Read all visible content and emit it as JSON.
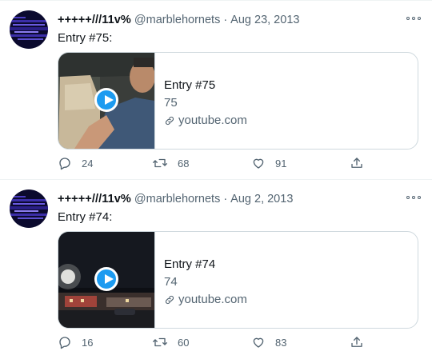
{
  "tweets": [
    {
      "name": "+++++///11v%",
      "handle": "@marblehornets",
      "separator": "·",
      "date": "Aug 23, 2013",
      "text": "Entry #75:",
      "card": {
        "title": "Entry #75",
        "description": "75",
        "domain": "youtube.com"
      },
      "actions": {
        "replies": "24",
        "retweets": "68",
        "likes": "91"
      }
    },
    {
      "name": "+++++///11v%",
      "handle": "@marblehornets",
      "separator": "·",
      "date": "Aug 2, 2013",
      "text": "Entry #74:",
      "card": {
        "title": "Entry #74",
        "description": "74",
        "domain": "youtube.com"
      },
      "actions": {
        "replies": "16",
        "retweets": "60",
        "likes": "83"
      }
    }
  ],
  "icons": {
    "more": "more-horizontal-icon",
    "reply": "reply-icon",
    "retweet": "retweet-icon",
    "like": "heart-icon",
    "share": "share-icon",
    "link": "link-icon",
    "play": "play-icon"
  },
  "colors": {
    "accent": "#1d9bf0",
    "text": "#0f1419",
    "secondary": "#536471",
    "border": "#cfd9de"
  }
}
